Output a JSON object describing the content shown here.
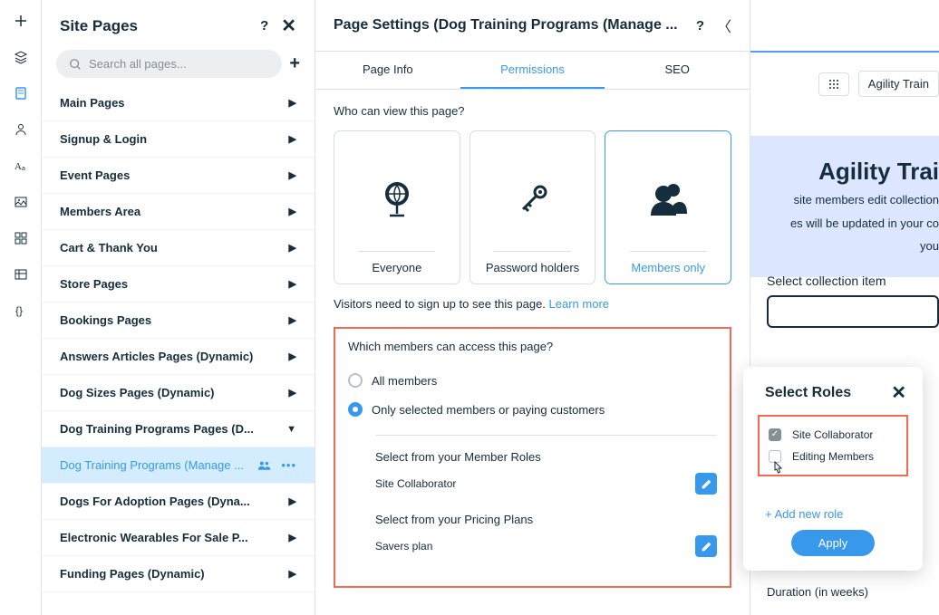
{
  "sidebar_title": "Site Pages",
  "search_placeholder": "Search all pages...",
  "page_groups": [
    {
      "label": "Main Pages",
      "expanded": false
    },
    {
      "label": "Signup & Login",
      "expanded": false
    },
    {
      "label": "Event Pages",
      "expanded": false
    },
    {
      "label": "Members Area",
      "expanded": false
    },
    {
      "label": "Cart & Thank You",
      "expanded": false
    },
    {
      "label": "Store Pages",
      "expanded": false
    },
    {
      "label": "Bookings Pages",
      "expanded": false
    },
    {
      "label": "Answers Articles Pages (Dynamic)",
      "expanded": false
    },
    {
      "label": "Dog Sizes Pages (Dynamic)",
      "expanded": false
    },
    {
      "label": "Dog Training Programs Pages (D...",
      "expanded": true
    },
    {
      "label": "Dogs For Adoption Pages (Dyna...",
      "expanded": false
    },
    {
      "label": "Electronic Wearables For Sale P...",
      "expanded": false
    },
    {
      "label": "Funding Pages (Dynamic)",
      "expanded": false
    }
  ],
  "selected_page": "Dog Training Programs (Manage ...",
  "settings": {
    "title": "Page Settings (Dog Training Programs (Manage ...",
    "tabs": {
      "info": "Page Info",
      "permissions": "Permissions",
      "seo": "SEO"
    },
    "view_question": "Who can view this page?",
    "options": {
      "everyone": "Everyone",
      "password": "Password holders",
      "members": "Members only"
    },
    "hint_text": "Visitors need to sign up to see this page. ",
    "hint_link": "Learn more",
    "members_question": "Which members can access this page?",
    "radio_all": "All members",
    "radio_selected": "Only selected members or paying customers",
    "roles_heading": "Select from your Member Roles",
    "roles_value": "Site Collaborator",
    "plans_heading": "Select from your Pricing Plans",
    "plans_value": "Savers plan"
  },
  "roles_pop": {
    "title": "Select Roles",
    "items": [
      {
        "label": "Site Collaborator",
        "checked": true
      },
      {
        "label": "Editing Members",
        "checked": false
      }
    ],
    "add_link": "+ Add new role",
    "apply": "Apply"
  },
  "canvas": {
    "chip": "Agility Train",
    "hero_title": "Agility Trai",
    "hero_line1": "site members edit collection",
    "hero_line2": "es will be updated in your co",
    "hero_line3": "you",
    "select_label": "Select collection item",
    "duration_label": "Duration (in weeks)"
  }
}
